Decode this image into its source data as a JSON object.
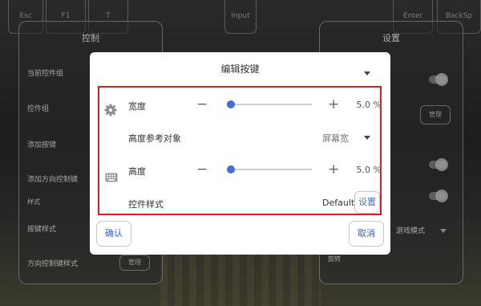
{
  "background": {
    "keys": [
      "Esc",
      "F1",
      "T",
      "Input",
      "Enter",
      "BackSp"
    ],
    "left_panel": {
      "title": "控制",
      "items": [
        "当前控件组",
        "控件组",
        "添加按键",
        "添加方向控制键",
        "样式",
        "按键样式",
        "方向控制键样式"
      ],
      "manage_label": "管理"
    },
    "right_panel": {
      "title": "设置",
      "manage_label": "管理",
      "partial_text": "游戏模式",
      "partial_text2": "旋转"
    }
  },
  "dialog": {
    "title": "编辑按键",
    "rows": {
      "width": {
        "label": "宽度",
        "value": "5.0 %",
        "minus": "−",
        "plus": "+",
        "level_percent": 5
      },
      "height_ref": {
        "label": "高度参考对象",
        "value": "屏幕宽"
      },
      "height": {
        "label": "高度",
        "value": "5.0 %",
        "minus": "−",
        "plus": "+",
        "level_percent": 5
      },
      "style": {
        "label": "控件样式",
        "default_value": "Default",
        "set_label": "设置"
      }
    },
    "icons": [
      "gear-icon",
      "keyboard-icon"
    ],
    "confirm_label": "确认",
    "cancel_label": "取消"
  },
  "colors": {
    "accent": "#3f6fd8",
    "highlight": "#e21d1d"
  }
}
